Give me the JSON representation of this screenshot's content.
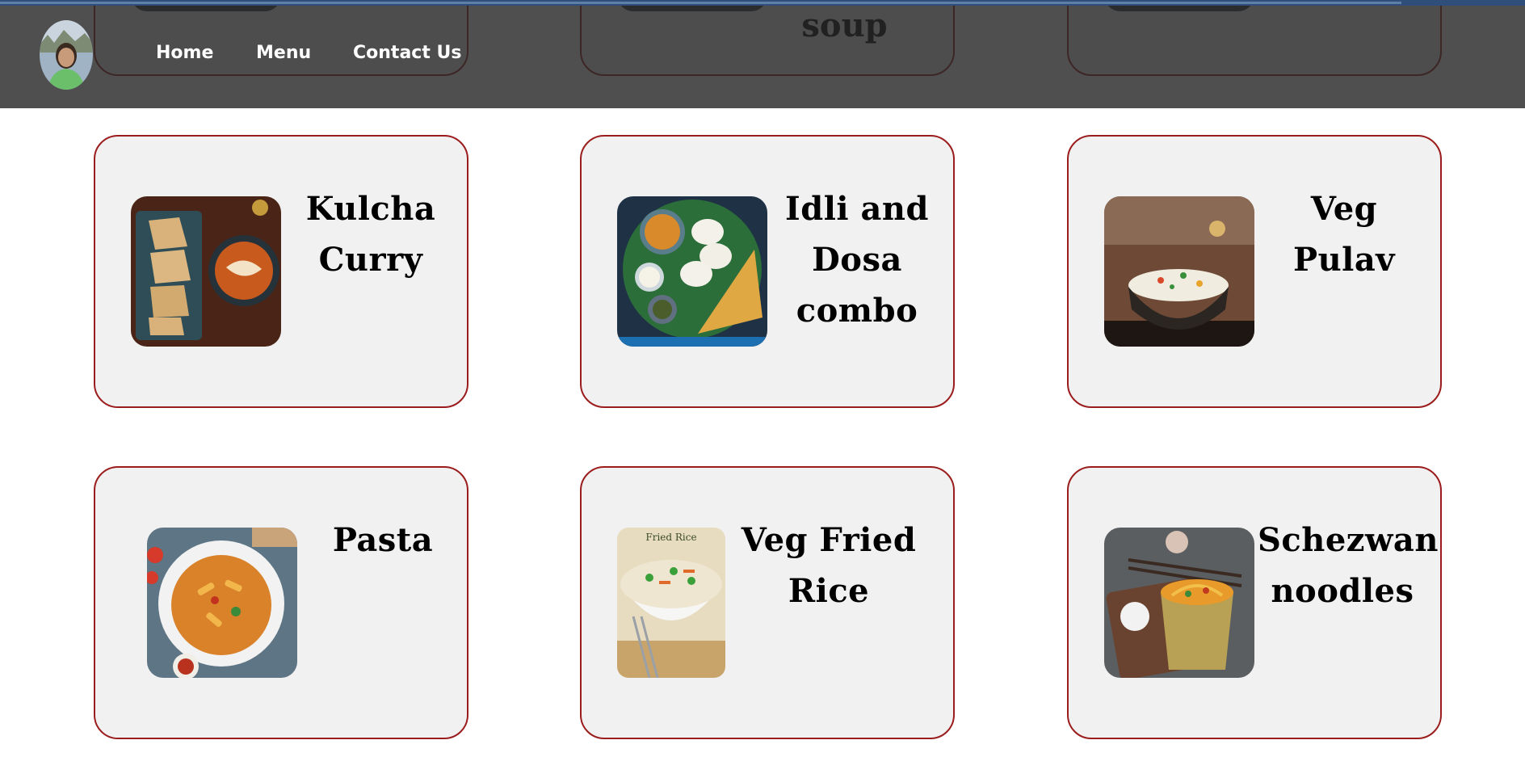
{
  "nav": {
    "links": [
      "Home",
      "Menu",
      "Contact Us"
    ]
  },
  "peek_row": {
    "visible_title": "soup"
  },
  "dishes": [
    {
      "name": "Kulcha Curry",
      "image": "kulcha-curry-photo"
    },
    {
      "name": "Idli and Dosa combo",
      "image": "idli-dosa-photo"
    },
    {
      "name": "Veg Pulav",
      "image": "veg-pulav-photo"
    },
    {
      "name": "Pasta",
      "image": "pasta-photo"
    },
    {
      "name": "Veg Fried Rice",
      "image": "veg-fried-rice-photo"
    },
    {
      "name": "Schezwan noodles",
      "image": "schezwan-noodles-photo"
    }
  ],
  "photo_captions": {
    "fried_rice_label": "Fried Rice"
  },
  "colors": {
    "card_border": "#9b1c1c",
    "card_bg": "#f1f1f1",
    "navbar": "#3a3a3a",
    "topline": "#2f4f7a"
  }
}
